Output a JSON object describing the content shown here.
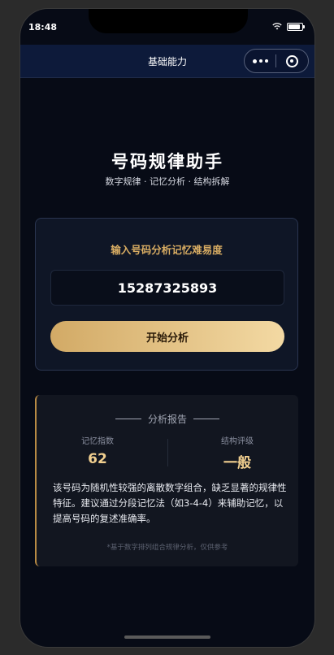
{
  "status": {
    "time": "18:48"
  },
  "navbar": {
    "title": "基础能力"
  },
  "hero": {
    "title": "号码规律助手",
    "subtitle": "数字规律 · 记忆分析 · 结构拆解"
  },
  "input_card": {
    "heading": "输入号码分析记忆难易度",
    "phone_value": "15287325893",
    "button_label": "开始分析"
  },
  "report": {
    "heading": "分析报告",
    "memory_index_label": "记忆指数",
    "memory_index_value": "62",
    "structure_rating_label": "结构评级",
    "structure_rating_value": "一般",
    "text": "该号码为随机性较强的离散数字组合，缺乏显著的规律性特征。建议通过分段记忆法（如3-4-4）来辅助记忆，以提高号码的复述准确率。",
    "footnote": "*基于数字排列组合规律分析，仅供参考"
  },
  "colors": {
    "accent_gold": "#d9ad63",
    "button_start": "#d2aa66",
    "button_end": "#f3d9a3"
  },
  "icons": [
    "wifi-icon",
    "battery-icon",
    "more-icon",
    "close-icon"
  ]
}
